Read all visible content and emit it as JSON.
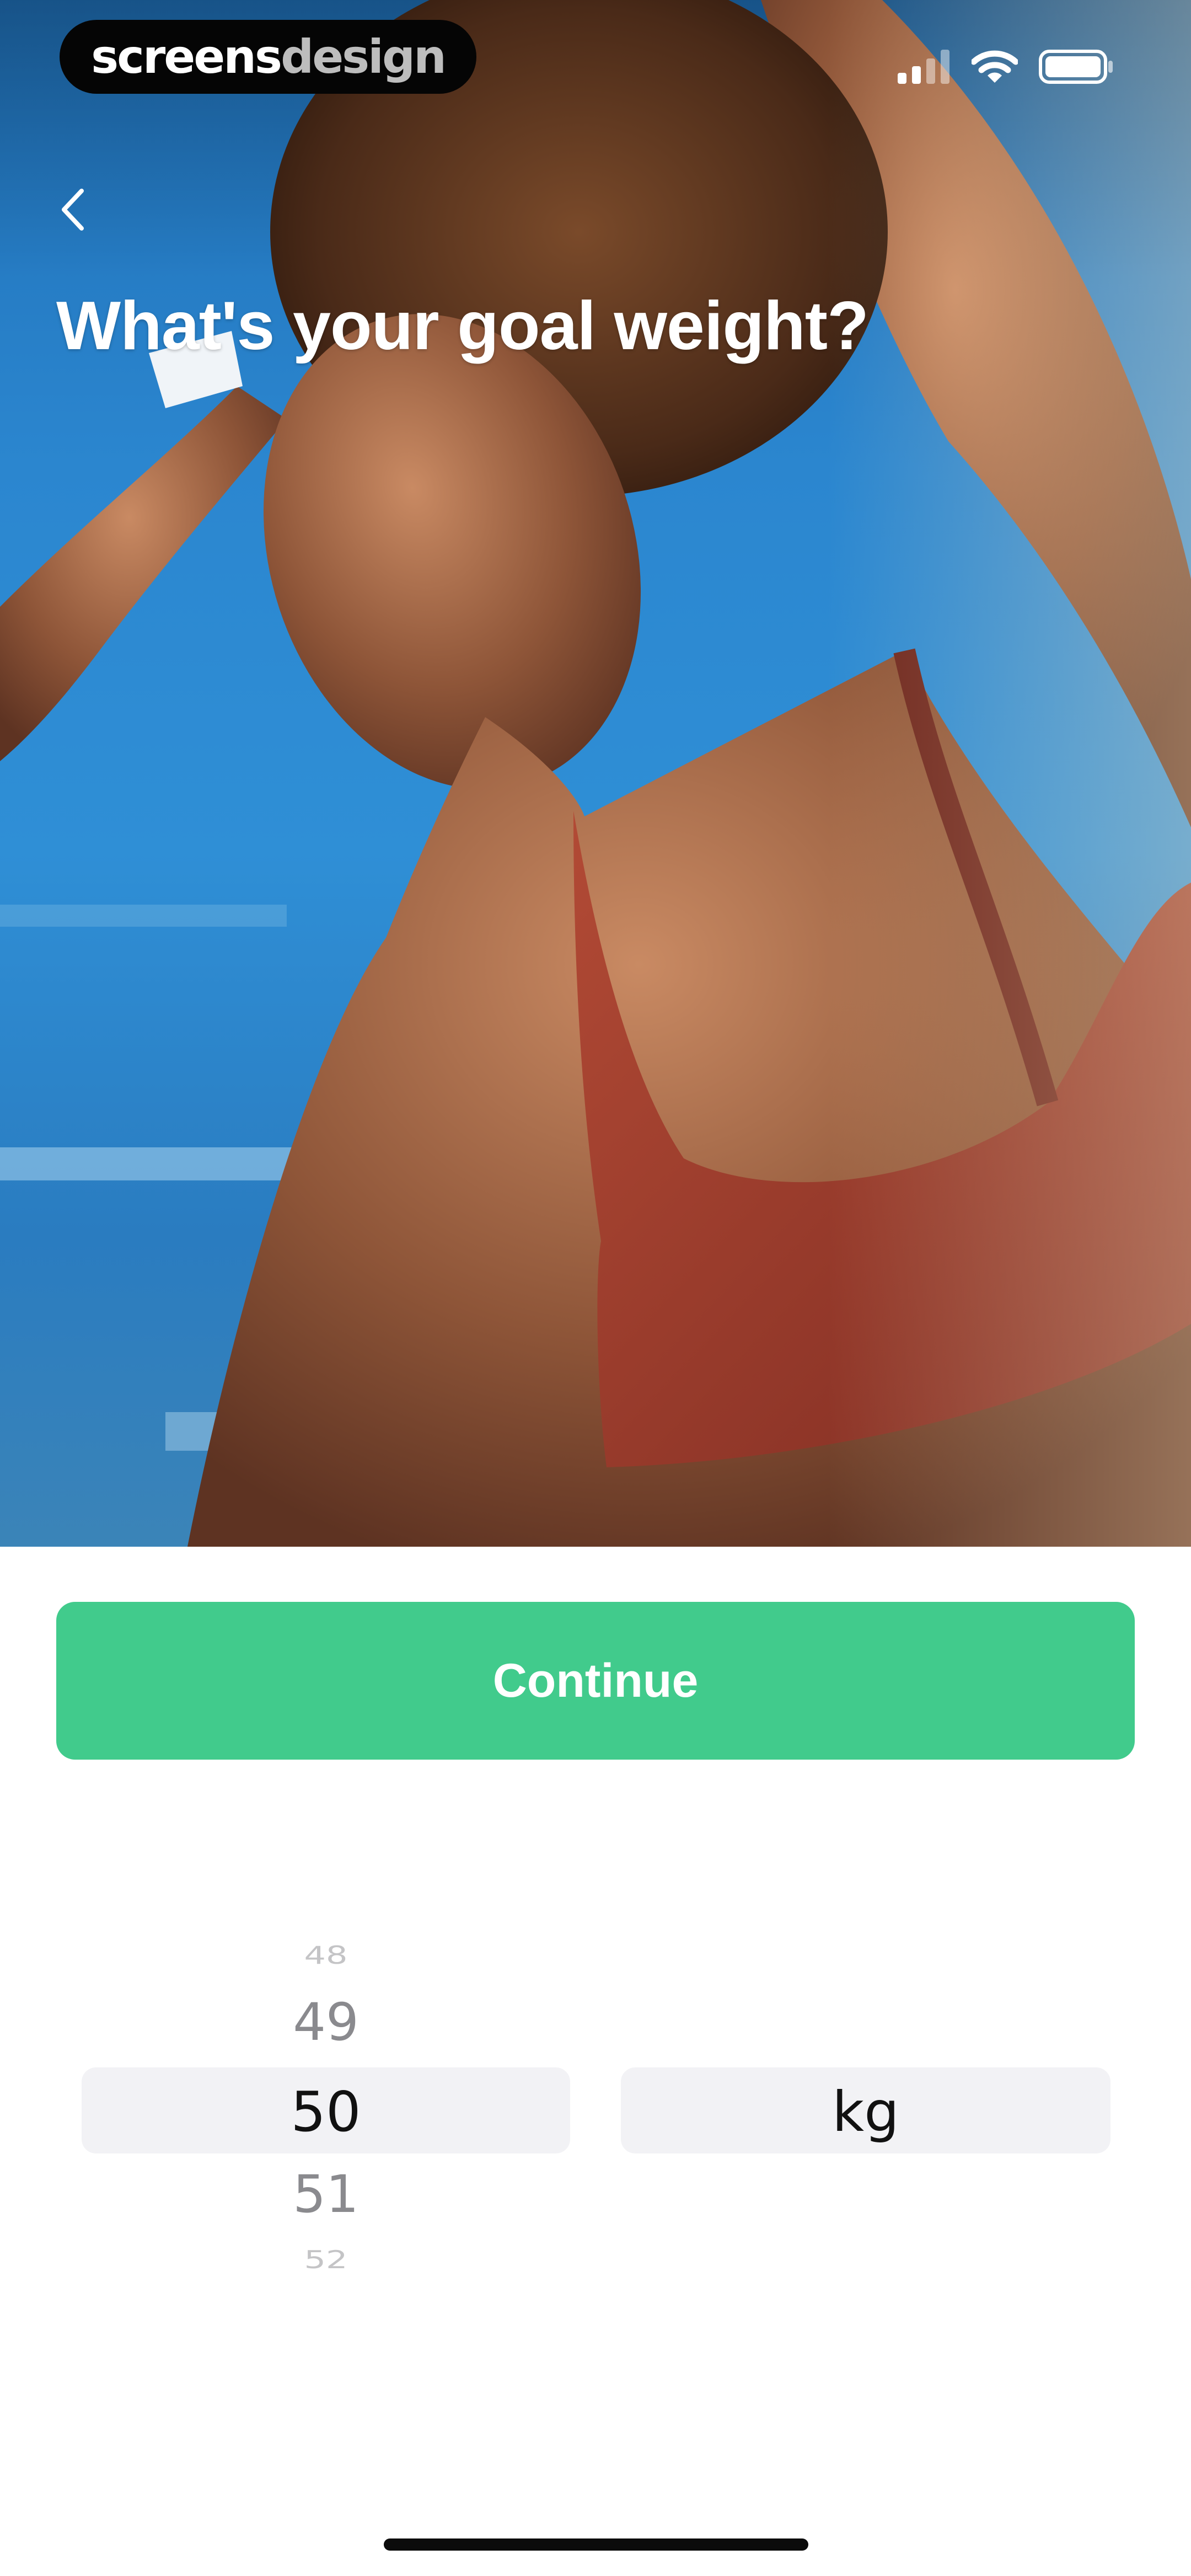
{
  "status_bar": {
    "brand_part1": "screens",
    "brand_part2": "design",
    "icons": [
      "cellular-signal-icon",
      "wifi-icon",
      "battery-icon"
    ]
  },
  "header": {
    "back_icon": "chevron-left-icon",
    "title": "What's your goal weight?"
  },
  "hero_image": {
    "description_icon": "photo"
  },
  "continue_button": {
    "label": "Continue"
  },
  "weight_picker": {
    "values": [
      "48",
      "49",
      "50",
      "51",
      "52"
    ],
    "selected": "50",
    "unit_options": [
      "kg"
    ],
    "selected_unit": "kg"
  },
  "colors": {
    "accent": "#41cb8c",
    "picker_highlight": "#f2f2f5"
  }
}
